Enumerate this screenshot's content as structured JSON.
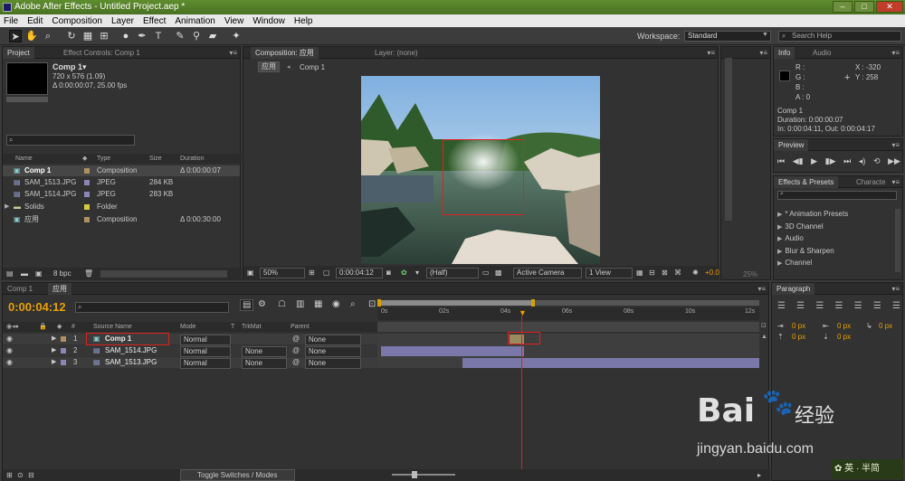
{
  "window": {
    "title": "Adobe After Effects - Untitled Project.aep *",
    "min": "–",
    "max": "□",
    "close": "✕"
  },
  "menu": [
    "File",
    "Edit",
    "Composition",
    "Layer",
    "Effect",
    "Animation",
    "View",
    "Window",
    "Help"
  ],
  "toolbar": {
    "workspace_label": "Workspace:",
    "workspace_value": "Standard",
    "search_placeholder": "Search Help"
  },
  "project": {
    "tab": "Project",
    "effect_controls_tab": "Effect Controls: Comp 1",
    "selected_name": "Comp 1▾",
    "selected_size": "720 x 576 (1.09)",
    "selected_duration": "Δ 0:00:00:07, 25.00 fps",
    "columns": {
      "name": "Name",
      "type": "Type",
      "size": "Size",
      "duration": "Duration"
    },
    "items": [
      {
        "name": "Comp 1",
        "type": "Composition",
        "size": "",
        "duration": "Δ 0:00:00:07",
        "selected": true
      },
      {
        "name": "SAM_1513.JPG",
        "type": "JPEG",
        "size": "284 KB",
        "duration": ""
      },
      {
        "name": "SAM_1514.JPG",
        "type": "JPEG",
        "size": "283 KB",
        "duration": ""
      },
      {
        "name": "Solids",
        "type": "Folder",
        "size": "",
        "duration": ""
      },
      {
        "name": "应用",
        "type": "Composition",
        "size": "",
        "duration": "Δ 0:00:30:00"
      }
    ],
    "bpc": "8 bpc"
  },
  "composition": {
    "tab": "Composition: 应用",
    "layer_tab": "Layer: (none)",
    "crumb_active": "应用",
    "crumb_next": "Comp 1",
    "zoom": "50%",
    "timecode": "0:00:04:12",
    "resolution": "(Half)",
    "camera": "Active Camera",
    "views": "1 View",
    "offset": "+0.0",
    "pct": "25%"
  },
  "info": {
    "tab": "Info",
    "audio_tab": "Audio",
    "r": "R :",
    "g": "G :",
    "b": "B :",
    "a": "A : 0",
    "x": "X : -320",
    "y": "Y : 258",
    "comp_name": "Comp 1",
    "duration": "Duration: 0:00:00:07",
    "in_out": "In: 0:00:04:11, Out: 0:00:04:17"
  },
  "preview": {
    "tab": "Preview"
  },
  "effects": {
    "tab": "Effects & Presets",
    "character_tab": "Characte",
    "items": [
      "* Animation Presets",
      "3D Channel",
      "Audio",
      "Blur & Sharpen",
      "Channel"
    ]
  },
  "paragraph": {
    "tab": "Paragraph",
    "values": [
      "0 px",
      "0 px",
      "0 px",
      "0 px",
      "0 px"
    ]
  },
  "timeline": {
    "tabs": [
      "Comp 1",
      "应用"
    ],
    "timecode": "0:00:04:12",
    "columns": {
      "source": "Source Name",
      "mode": "Mode",
      "t": "T",
      "trkmat": "TrkMat",
      "parent": "Parent"
    },
    "layers": [
      {
        "num": "1",
        "name": "Comp 1",
        "mode": "Normal",
        "trkmat": "",
        "parent": "None"
      },
      {
        "num": "2",
        "name": "SAM_1514.JPG",
        "mode": "Normal",
        "trkmat": "None",
        "parent": "None"
      },
      {
        "num": "3",
        "name": "SAM_1513.JPG",
        "mode": "Normal",
        "trkmat": "None",
        "parent": "None"
      }
    ],
    "ruler": [
      "0s",
      "02s",
      "04s",
      "06s",
      "08s",
      "10s",
      "12s"
    ],
    "toggle": "Toggle Switches / Modes"
  },
  "watermark": {
    "site": "jingyan.baidu.com",
    "brand": "Bai",
    "brand2": "经验",
    "stamp": "英 · 半简"
  }
}
